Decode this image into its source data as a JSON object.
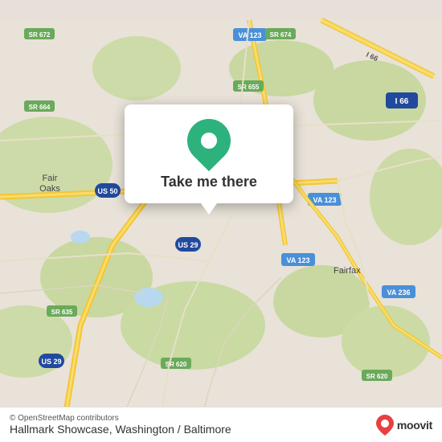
{
  "map": {
    "attribution": "© OpenStreetMap contributors",
    "location_label": "Hallmark Showcase, Washington / Baltimore",
    "popup_button_label": "Take me there",
    "moovit_logo_text": "moovit",
    "bg_color": "#ede8e0"
  },
  "roads": {
    "color_main": "#f5c842",
    "color_secondary": "#f0b830",
    "color_highway": "#f9dd6b",
    "color_minor": "#ffffff",
    "color_green": "#c8dba0",
    "color_water": "#a8d4f0"
  }
}
